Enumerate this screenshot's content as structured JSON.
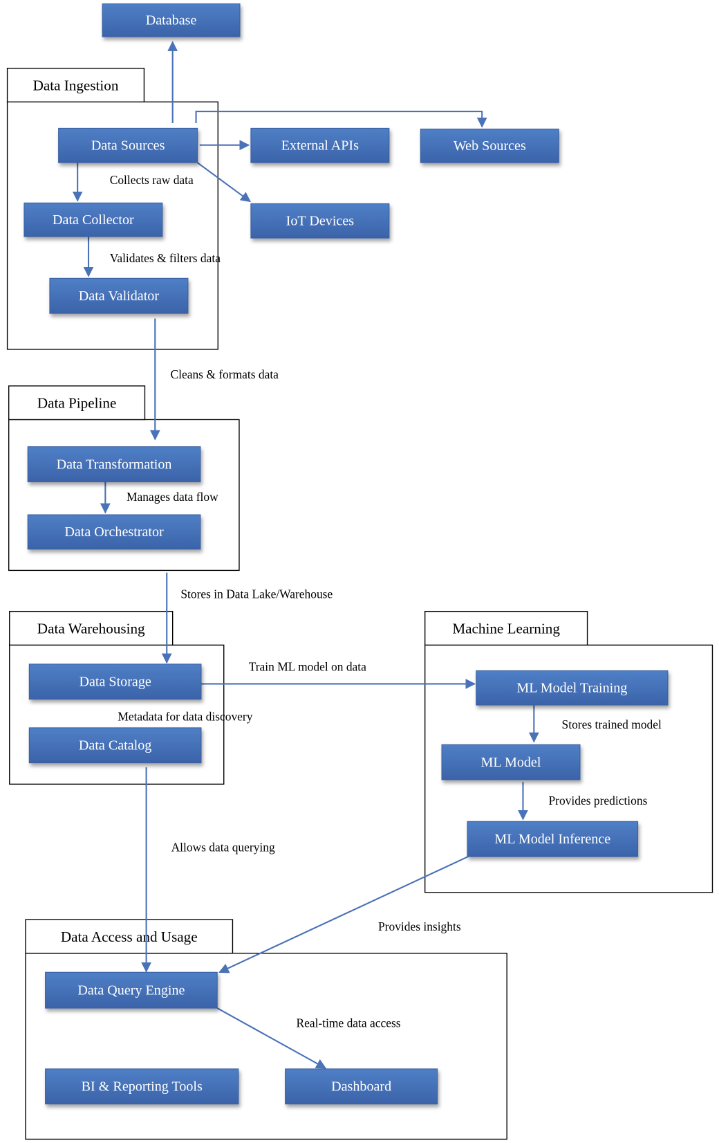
{
  "colors": {
    "node_top": "#4f7fc6",
    "node_bottom": "#3b63a9",
    "edge": "#4a72b8",
    "frame": "#000000"
  },
  "groups": [
    {
      "id": "ingestion",
      "label": "Data Ingestion"
    },
    {
      "id": "pipeline",
      "label": "Data Pipeline"
    },
    {
      "id": "warehousing",
      "label": "Data Warehousing"
    },
    {
      "id": "ml",
      "label": "Machine Learning"
    },
    {
      "id": "access",
      "label": "Data Access and Usage"
    }
  ],
  "nodes": [
    {
      "id": "database",
      "label": "Database"
    },
    {
      "id": "data-sources",
      "label": "Data Sources"
    },
    {
      "id": "external-apis",
      "label": "External APIs"
    },
    {
      "id": "web-sources",
      "label": "Web Sources"
    },
    {
      "id": "data-collector",
      "label": "Data Collector"
    },
    {
      "id": "iot-devices",
      "label": "IoT Devices"
    },
    {
      "id": "data-validator",
      "label": "Data Validator"
    },
    {
      "id": "data-transformation",
      "label": "Data Transformation"
    },
    {
      "id": "data-orchestrator",
      "label": "Data Orchestrator"
    },
    {
      "id": "data-storage",
      "label": "Data Storage"
    },
    {
      "id": "data-catalog",
      "label": "Data Catalog"
    },
    {
      "id": "ml-model-training",
      "label": "ML Model Training"
    },
    {
      "id": "ml-model",
      "label": "ML Model"
    },
    {
      "id": "ml-model-inference",
      "label": "ML Model Inference"
    },
    {
      "id": "data-query-engine",
      "label": "Data Query Engine"
    },
    {
      "id": "bi-reporting-tools",
      "label": "BI & Reporting Tools"
    },
    {
      "id": "dashboard",
      "label": "Dashboard"
    }
  ],
  "edges": [
    {
      "from": "data-sources",
      "to": "database",
      "label": ""
    },
    {
      "from": "data-sources",
      "to": "web-sources",
      "label": ""
    },
    {
      "from": "data-sources",
      "to": "external-apis",
      "label": ""
    },
    {
      "from": "data-sources",
      "to": "iot-devices",
      "label": ""
    },
    {
      "from": "data-sources",
      "to": "data-collector",
      "label": "Collects raw data"
    },
    {
      "from": "data-collector",
      "to": "data-validator",
      "label": "Validates & filters data"
    },
    {
      "from": "data-validator",
      "to": "data-transformation",
      "label": "Cleans & formats data"
    },
    {
      "from": "data-transformation",
      "to": "data-orchestrator",
      "label": "Manages data flow"
    },
    {
      "from": "data-orchestrator",
      "to": "data-storage",
      "label": "Stores in Data Lake/Warehouse"
    },
    {
      "from": "data-storage",
      "to": "data-catalog",
      "label": "Metadata for data discovery"
    },
    {
      "from": "data-storage",
      "to": "ml-model-training",
      "label": "Train ML model on data"
    },
    {
      "from": "ml-model-training",
      "to": "ml-model",
      "label": "Stores trained model"
    },
    {
      "from": "ml-model",
      "to": "ml-model-inference",
      "label": "Provides predictions"
    },
    {
      "from": "data-catalog",
      "to": "data-query-engine",
      "label": "Allows data querying"
    },
    {
      "from": "ml-model-inference",
      "to": "data-query-engine",
      "label": "Provides insights"
    },
    {
      "from": "data-query-engine",
      "to": "dashboard",
      "label": "Real-time data access"
    }
  ]
}
